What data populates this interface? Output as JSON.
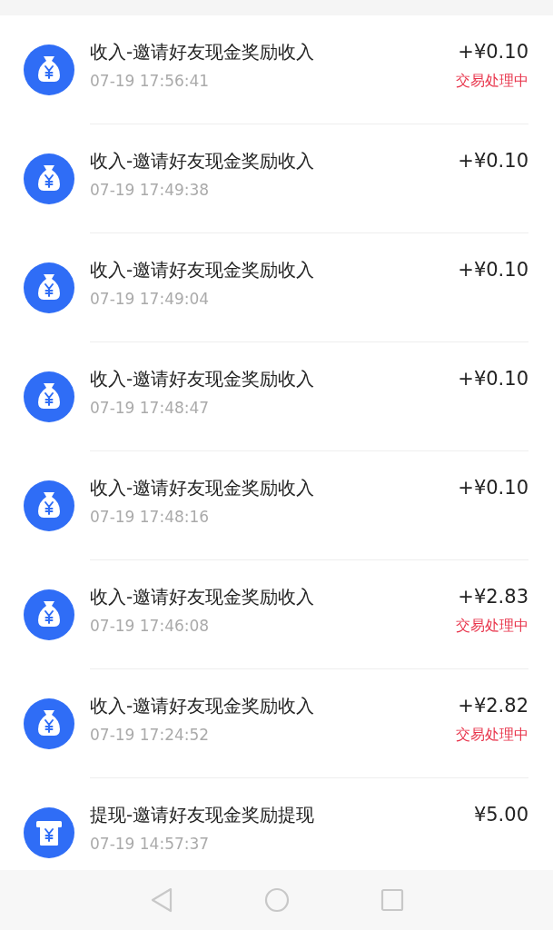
{
  "transactions": [
    {
      "kind": "income",
      "title": "收入-邀请好友现金奖励收入",
      "time": "07-19 17:56:41",
      "amount": "+¥0.10",
      "status": "交易处理中"
    },
    {
      "kind": "income",
      "title": "收入-邀请好友现金奖励收入",
      "time": "07-19 17:49:38",
      "amount": "+¥0.10"
    },
    {
      "kind": "income",
      "title": "收入-邀请好友现金奖励收入",
      "time": "07-19 17:49:04",
      "amount": "+¥0.10"
    },
    {
      "kind": "income",
      "title": "收入-邀请好友现金奖励收入",
      "time": "07-19 17:48:47",
      "amount": "+¥0.10"
    },
    {
      "kind": "income",
      "title": "收入-邀请好友现金奖励收入",
      "time": "07-19 17:48:16",
      "amount": "+¥0.10"
    },
    {
      "kind": "income",
      "title": "收入-邀请好友现金奖励收入",
      "time": "07-19 17:46:08",
      "amount": "+¥2.83",
      "status": "交易处理中"
    },
    {
      "kind": "income",
      "title": "收入-邀请好友现金奖励收入",
      "time": "07-19 17:24:52",
      "amount": "+¥2.82",
      "status": "交易处理中"
    },
    {
      "kind": "withdrawal",
      "title": "提现-邀请好友现金奖励提现",
      "time": "07-19 14:57:37",
      "amount": "¥5.00"
    }
  ]
}
